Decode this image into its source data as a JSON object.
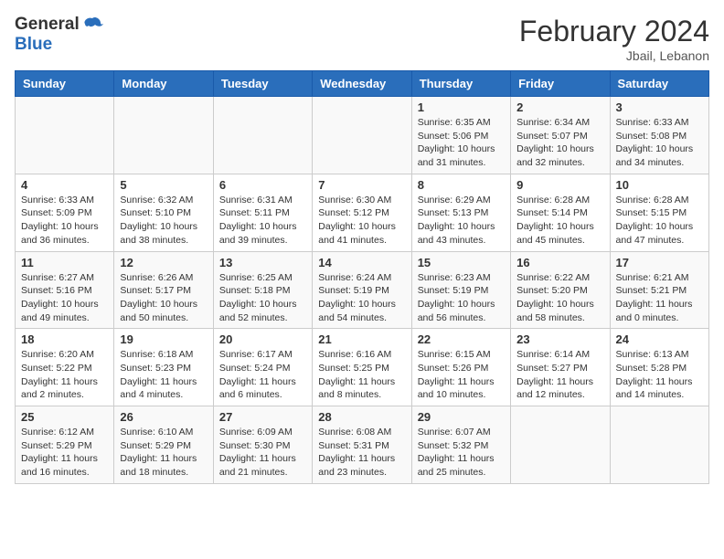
{
  "header": {
    "logo_general": "General",
    "logo_blue": "Blue",
    "month_year": "February 2024",
    "location": "Jbail, Lebanon"
  },
  "weekdays": [
    "Sunday",
    "Monday",
    "Tuesday",
    "Wednesday",
    "Thursday",
    "Friday",
    "Saturday"
  ],
  "weeks": [
    [
      {
        "day": "",
        "info": ""
      },
      {
        "day": "",
        "info": ""
      },
      {
        "day": "",
        "info": ""
      },
      {
        "day": "",
        "info": ""
      },
      {
        "day": "1",
        "info": "Sunrise: 6:35 AM\nSunset: 5:06 PM\nDaylight: 10 hours\nand 31 minutes."
      },
      {
        "day": "2",
        "info": "Sunrise: 6:34 AM\nSunset: 5:07 PM\nDaylight: 10 hours\nand 32 minutes."
      },
      {
        "day": "3",
        "info": "Sunrise: 6:33 AM\nSunset: 5:08 PM\nDaylight: 10 hours\nand 34 minutes."
      }
    ],
    [
      {
        "day": "4",
        "info": "Sunrise: 6:33 AM\nSunset: 5:09 PM\nDaylight: 10 hours\nand 36 minutes."
      },
      {
        "day": "5",
        "info": "Sunrise: 6:32 AM\nSunset: 5:10 PM\nDaylight: 10 hours\nand 38 minutes."
      },
      {
        "day": "6",
        "info": "Sunrise: 6:31 AM\nSunset: 5:11 PM\nDaylight: 10 hours\nand 39 minutes."
      },
      {
        "day": "7",
        "info": "Sunrise: 6:30 AM\nSunset: 5:12 PM\nDaylight: 10 hours\nand 41 minutes."
      },
      {
        "day": "8",
        "info": "Sunrise: 6:29 AM\nSunset: 5:13 PM\nDaylight: 10 hours\nand 43 minutes."
      },
      {
        "day": "9",
        "info": "Sunrise: 6:28 AM\nSunset: 5:14 PM\nDaylight: 10 hours\nand 45 minutes."
      },
      {
        "day": "10",
        "info": "Sunrise: 6:28 AM\nSunset: 5:15 PM\nDaylight: 10 hours\nand 47 minutes."
      }
    ],
    [
      {
        "day": "11",
        "info": "Sunrise: 6:27 AM\nSunset: 5:16 PM\nDaylight: 10 hours\nand 49 minutes."
      },
      {
        "day": "12",
        "info": "Sunrise: 6:26 AM\nSunset: 5:17 PM\nDaylight: 10 hours\nand 50 minutes."
      },
      {
        "day": "13",
        "info": "Sunrise: 6:25 AM\nSunset: 5:18 PM\nDaylight: 10 hours\nand 52 minutes."
      },
      {
        "day": "14",
        "info": "Sunrise: 6:24 AM\nSunset: 5:19 PM\nDaylight: 10 hours\nand 54 minutes."
      },
      {
        "day": "15",
        "info": "Sunrise: 6:23 AM\nSunset: 5:19 PM\nDaylight: 10 hours\nand 56 minutes."
      },
      {
        "day": "16",
        "info": "Sunrise: 6:22 AM\nSunset: 5:20 PM\nDaylight: 10 hours\nand 58 minutes."
      },
      {
        "day": "17",
        "info": "Sunrise: 6:21 AM\nSunset: 5:21 PM\nDaylight: 11 hours\nand 0 minutes."
      }
    ],
    [
      {
        "day": "18",
        "info": "Sunrise: 6:20 AM\nSunset: 5:22 PM\nDaylight: 11 hours\nand 2 minutes."
      },
      {
        "day": "19",
        "info": "Sunrise: 6:18 AM\nSunset: 5:23 PM\nDaylight: 11 hours\nand 4 minutes."
      },
      {
        "day": "20",
        "info": "Sunrise: 6:17 AM\nSunset: 5:24 PM\nDaylight: 11 hours\nand 6 minutes."
      },
      {
        "day": "21",
        "info": "Sunrise: 6:16 AM\nSunset: 5:25 PM\nDaylight: 11 hours\nand 8 minutes."
      },
      {
        "day": "22",
        "info": "Sunrise: 6:15 AM\nSunset: 5:26 PM\nDaylight: 11 hours\nand 10 minutes."
      },
      {
        "day": "23",
        "info": "Sunrise: 6:14 AM\nSunset: 5:27 PM\nDaylight: 11 hours\nand 12 minutes."
      },
      {
        "day": "24",
        "info": "Sunrise: 6:13 AM\nSunset: 5:28 PM\nDaylight: 11 hours\nand 14 minutes."
      }
    ],
    [
      {
        "day": "25",
        "info": "Sunrise: 6:12 AM\nSunset: 5:29 PM\nDaylight: 11 hours\nand 16 minutes."
      },
      {
        "day": "26",
        "info": "Sunrise: 6:10 AM\nSunset: 5:29 PM\nDaylight: 11 hours\nand 18 minutes."
      },
      {
        "day": "27",
        "info": "Sunrise: 6:09 AM\nSunset: 5:30 PM\nDaylight: 11 hours\nand 21 minutes."
      },
      {
        "day": "28",
        "info": "Sunrise: 6:08 AM\nSunset: 5:31 PM\nDaylight: 11 hours\nand 23 minutes."
      },
      {
        "day": "29",
        "info": "Sunrise: 6:07 AM\nSunset: 5:32 PM\nDaylight: 11 hours\nand 25 minutes."
      },
      {
        "day": "",
        "info": ""
      },
      {
        "day": "",
        "info": ""
      }
    ]
  ]
}
